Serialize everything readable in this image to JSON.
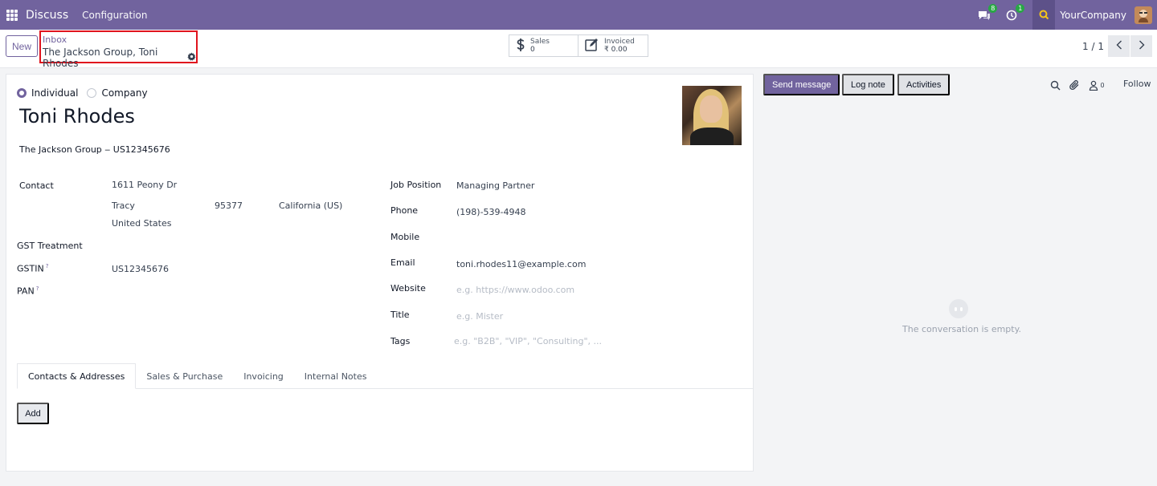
{
  "navbar": {
    "brand": "Discuss",
    "menu": [
      "Configuration"
    ],
    "messages_badge": "8",
    "activities_badge": "1",
    "company_name": "YourCompany"
  },
  "control_panel": {
    "new_label": "New",
    "breadcrumb_parent": "Inbox",
    "breadcrumb_current": "The Jackson Group, Toni Rhodes",
    "stats": [
      {
        "label": "Sales",
        "value": "0",
        "icon": "dollar-icon"
      },
      {
        "label": "Invoiced",
        "value": "₹ 0.00",
        "icon": "invoice-icon"
      }
    ],
    "pager": "1 / 1"
  },
  "form": {
    "company_type_options": [
      "Individual",
      "Company"
    ],
    "company_type_selected": "Individual",
    "name": "Toni Rhodes",
    "parent_company": "The Jackson Group ‒ US12345676",
    "left_fields": {
      "contact_label": "Contact",
      "street": "1611 Peony Dr",
      "city": "Tracy",
      "zip": "95377",
      "state": "California (US)",
      "country": "United States",
      "gst_treatment_label": "GST Treatment",
      "gstin_label": "GSTIN",
      "gstin_value": "US12345676",
      "pan_label": "PAN",
      "help_mark": "?"
    },
    "right_fields": {
      "job_position_label": "Job Position",
      "job_position_value": "Managing Partner",
      "phone_label": "Phone",
      "phone_value": "(198)-539-4948",
      "mobile_label": "Mobile",
      "email_label": "Email",
      "email_value": "toni.rhodes11@example.com",
      "website_label": "Website",
      "website_placeholder": "e.g. https://www.odoo.com",
      "title_label": "Title",
      "title_placeholder": "e.g. Mister",
      "tags_label": "Tags",
      "tags_placeholder": "e.g. \"B2B\", \"VIP\", \"Consulting\", ..."
    },
    "tabs": [
      "Contacts & Addresses",
      "Sales & Purchase",
      "Invoicing",
      "Internal Notes"
    ],
    "active_tab": "Contacts & Addresses",
    "add_label": "Add"
  },
  "chatter": {
    "send_message": "Send message",
    "log_note": "Log note",
    "activities": "Activities",
    "followers_count": "0",
    "follow": "Follow",
    "empty_text": "The conversation is empty."
  },
  "colors": {
    "brand": "#71639e",
    "highlight_box": "#e0141e"
  }
}
